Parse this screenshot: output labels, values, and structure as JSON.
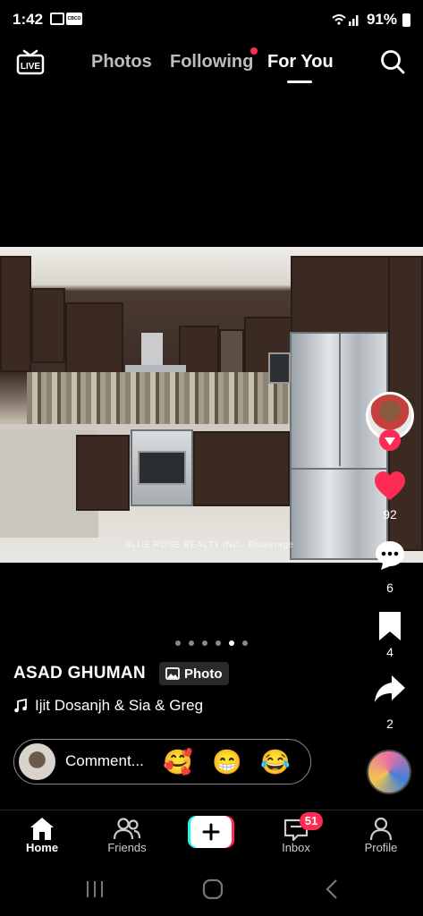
{
  "status_bar": {
    "time": "1:42",
    "battery": "91%",
    "notif_label": "CBCO"
  },
  "top_nav": {
    "live_label": "LIVE",
    "tabs": [
      {
        "label": "Photos"
      },
      {
        "label": "Following"
      },
      {
        "label": "For You"
      }
    ],
    "active_tab": "For You"
  },
  "post": {
    "watermark": "BLUE ROSE REALTY INC., Brokerage",
    "username": "ASAD  GHUMAN",
    "type_badge": "Photo",
    "music": "Ijit Dosanjh & Sia & Greg",
    "carousel": {
      "count": 6,
      "active_index": 4
    },
    "likes": "92",
    "comments": "6",
    "saves": "4",
    "shares": "2"
  },
  "comment_bar": {
    "placeholder": "Comment...",
    "emojis": [
      "🥰",
      "😁",
      "😂"
    ]
  },
  "bottom_nav": {
    "items": [
      {
        "label": "Home"
      },
      {
        "label": "Friends"
      },
      {
        "label": ""
      },
      {
        "label": "Inbox"
      },
      {
        "label": "Profile"
      }
    ],
    "inbox_badge": "51"
  },
  "colors": {
    "accent": "#fe2c55",
    "cyan": "#25f4ee",
    "background": "#000000"
  }
}
